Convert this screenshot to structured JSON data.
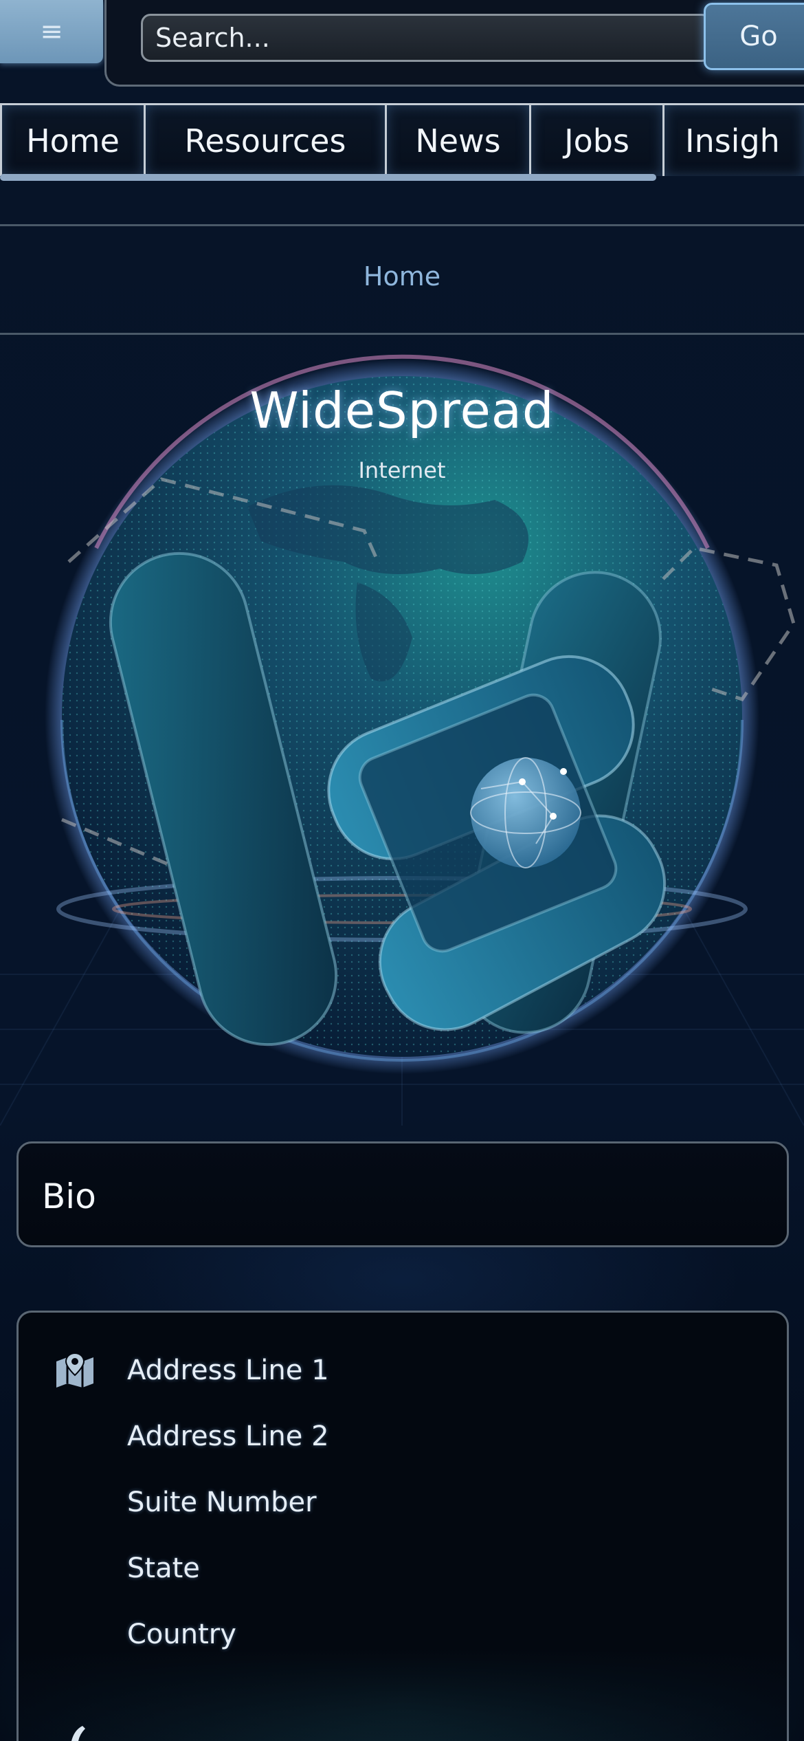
{
  "header": {
    "menu_icon": "hamburger-icon",
    "search_placeholder": "Search...",
    "go_label": "Go"
  },
  "nav": {
    "tabs": [
      "Home",
      "Resources",
      "News",
      "Jobs",
      "Insigh"
    ]
  },
  "breadcrumb": "Home",
  "hero": {
    "title": "WideSpread",
    "subtitle": "Internet"
  },
  "bio": {
    "title": "Bio"
  },
  "address": {
    "icon": "map-icon",
    "lines": [
      "Address Line 1",
      "Address Line 2",
      "Suite Number",
      "State",
      "Country"
    ]
  },
  "colors": {
    "background": "#030b19",
    "accent": "#8fb6dc",
    "go_button": "#4d7699"
  }
}
